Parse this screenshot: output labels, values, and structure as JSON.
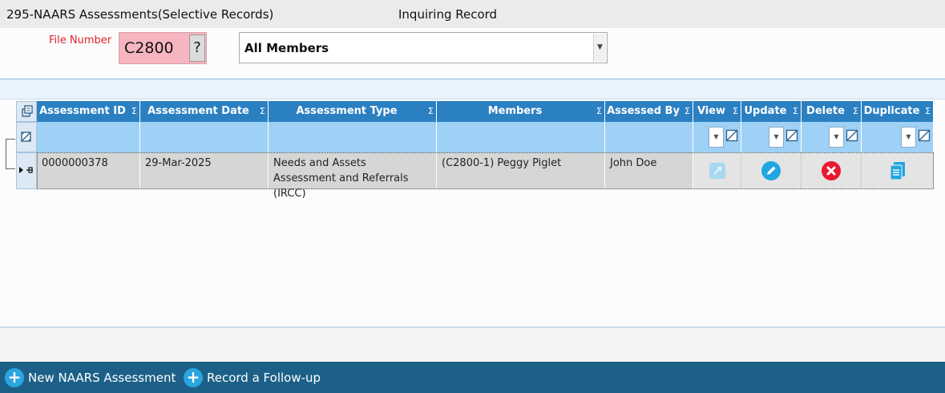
{
  "window": {
    "title": "295-NAARS Assessments(Selective Records)",
    "mode": "Inquiring Record"
  },
  "filters": {
    "file_number_label": "File Number",
    "file_number_value": "C2800",
    "lookup_button_label": "?",
    "members_selected": "All Members"
  },
  "grid": {
    "sum_symbol": "Σ",
    "columns": [
      {
        "key": "assessment_id",
        "label": "Assessment ID"
      },
      {
        "key": "assessment_date",
        "label": "Assessment Date"
      },
      {
        "key": "assessment_type",
        "label": "Assessment Type"
      },
      {
        "key": "members",
        "label": "Members"
      },
      {
        "key": "assessed_by",
        "label": "Assessed By"
      },
      {
        "key": "view",
        "label": "View"
      },
      {
        "key": "update",
        "label": "Update"
      },
      {
        "key": "delete",
        "label": "Delete"
      },
      {
        "key": "duplicate",
        "label": "Duplicate"
      }
    ],
    "rows": [
      {
        "assessment_id": "0000000378",
        "assessment_date": "29-Mar-2025",
        "assessment_type": "Needs and Assets Assessment and Referrals (IRCC)",
        "members": "(C2800-1) Peggy Piglet",
        "assessed_by": "John Doe",
        "view_icon": "view-icon",
        "update_icon": "pencil-icon",
        "delete_icon": "delete-x-icon",
        "duplicate_icon": "duplicate-icon"
      }
    ]
  },
  "footer": {
    "new_assessment_label": "New NAARS Assessment",
    "record_followup_label": "Record a Follow-up"
  },
  "colors": {
    "header_blue": "#2b80c2",
    "filter_row_blue": "#9fd1f7",
    "footer_bar": "#1c6087",
    "file_number_bg": "#f7b5bf",
    "label_red": "#e4202e"
  }
}
